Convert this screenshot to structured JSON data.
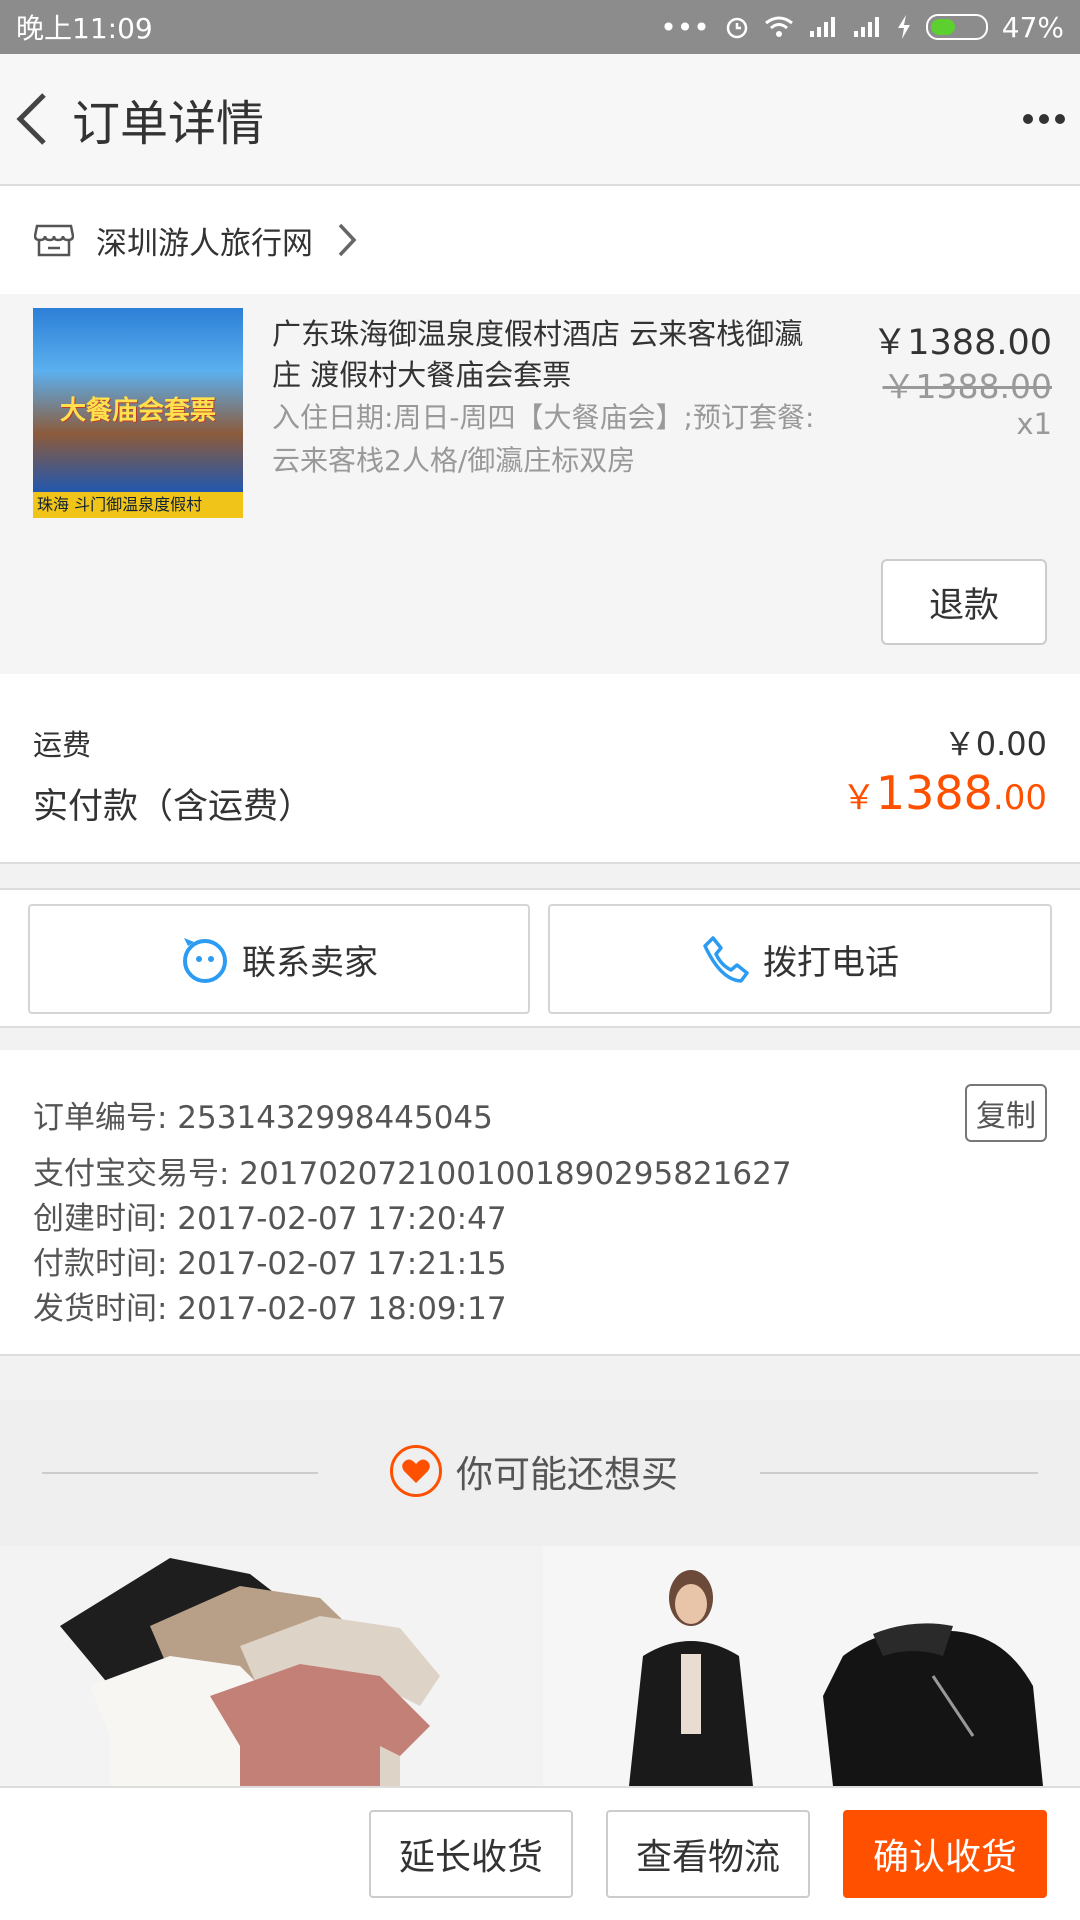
{
  "status_bar": {
    "time": "晚上11:09",
    "battery": "47%",
    "battery_level": 0.47
  },
  "nav": {
    "title": "订单详情"
  },
  "shop": {
    "name": "深圳游人旅行网"
  },
  "item": {
    "image_banner": "大餐庙会套票",
    "image_bottom": "珠海 斗门御温泉度假村",
    "title": "广东珠海御温泉度假村酒店 云来客栈御瀛庄 渡假村大餐庙会套票",
    "sku": "入住日期:周日-周四【大餐庙会】;预订套餐:云来客栈2人格/御瀛庄标双房",
    "price_now": "￥1388.00",
    "price_old": "￥1388.00",
    "quantity": "x1",
    "refund_label": "退款"
  },
  "summary": {
    "freight_label": "运费",
    "freight_value": "￥0.00",
    "paid_label": "实付款（含运费）",
    "paid_currency": "￥",
    "paid_int": "1388",
    "paid_cents": ".00"
  },
  "contact": {
    "seller_label": "联系卖家",
    "phone_label": "拨打电话"
  },
  "order": {
    "order_no": "订单编号: 2531432998445045",
    "alipay_no": "支付宝交易号: 2017020721001001890295821627",
    "created": "创建时间: 2017-02-07 17:20:47",
    "paid": "付款时间: 2017-02-07 17:21:15",
    "shipped": "发货时间: 2017-02-07 18:09:17",
    "copy_label": "复制"
  },
  "recommend": {
    "title": "你可能还想买"
  },
  "bottom_bar": {
    "extend_label": "延长收货",
    "logistics_label": "查看物流",
    "confirm_label": "确认收货"
  },
  "colors": {
    "accent": "#ff5000",
    "status_bar": "#8c8c8c",
    "contact_icon_blue": "#2b9cf2"
  }
}
